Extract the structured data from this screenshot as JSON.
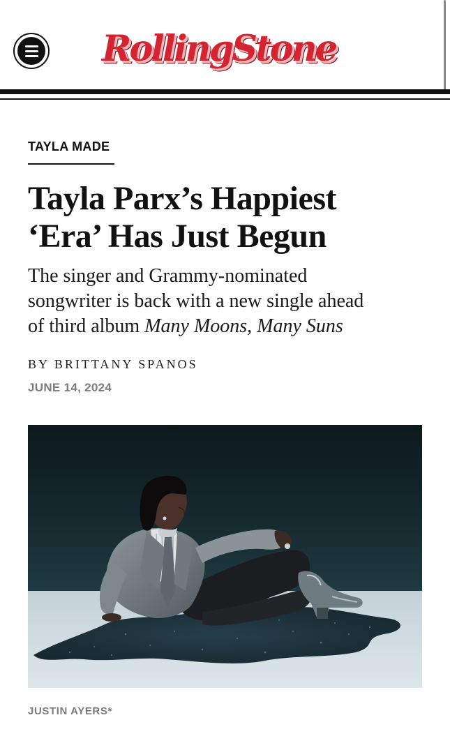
{
  "header": {
    "menu_icon": "hamburger-menu-icon",
    "logo_text": "RollingStone",
    "brand_color": "#d32531"
  },
  "article": {
    "kicker": "TAYLA MADE",
    "headline_lines": [
      "Tayla Parx’s Happiest",
      "‘Era’ Has Just Begun"
    ],
    "dek": {
      "line1": "The singer and Grammy-nominated",
      "line2": "songwriter is back with a new single ahead",
      "line3_prefix": "of third album ",
      "line3_italic": "Many Moons, Many Suns"
    },
    "byline_prefix": "BY ",
    "byline_author": "BRITTANY SPANOS",
    "date": "JUNE 14, 2024"
  },
  "hero_image": {
    "subject": "woman-in-grey-suit-reclining-on-floor",
    "credit": "JUSTIN AYERS*"
  }
}
